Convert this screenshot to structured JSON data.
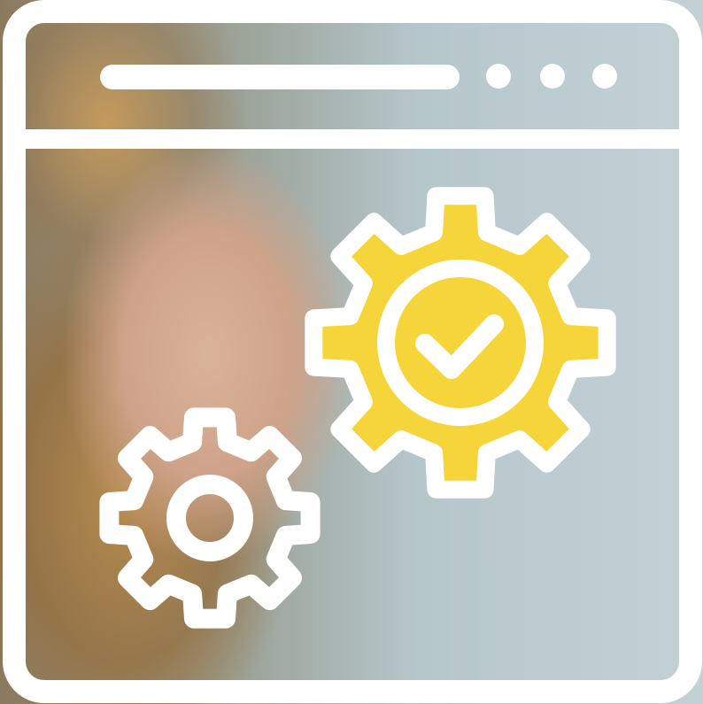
{
  "scene": {
    "kind": "browser-window-settings-illustration"
  },
  "icons": {
    "window": "browser-window-icon",
    "address_bar": "address-bar-icon",
    "menu_dots": "more-dots-icon",
    "large_gear": "gear-checkmark-icon",
    "small_gear": "gear-icon"
  },
  "colors": {
    "outline": "#ffffff",
    "gear_fill": "#f6d53a",
    "photo_tint": "#9fb9c0"
  }
}
